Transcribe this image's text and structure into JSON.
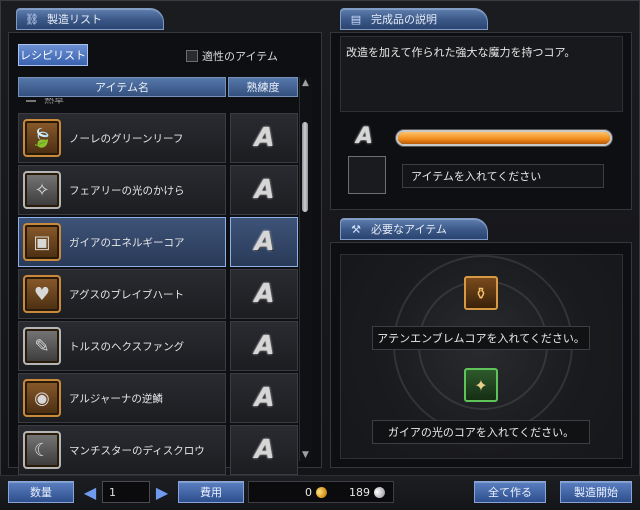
{
  "left_panel": {
    "title": "製造リスト",
    "recipe_list_button": "レシピリスト",
    "suitable_items_label": "適性のアイテム",
    "columns": {
      "item_name": "アイテム名",
      "proficiency": "熟練度"
    },
    "category": "熟草",
    "items": [
      {
        "name": "ノーレのグリーンリーフ",
        "grade": "A",
        "icon": "leaf-icon"
      },
      {
        "name": "フェアリーの光のかけら",
        "grade": "A",
        "icon": "crystal-icon"
      },
      {
        "name": "ガイアのエネルギーコア",
        "grade": "A",
        "icon": "core-icon",
        "selected": true
      },
      {
        "name": "アグスのブレイブハート",
        "grade": "A",
        "icon": "heart-icon"
      },
      {
        "name": "トルスのヘクスファング",
        "grade": "A",
        "icon": "fang-icon"
      },
      {
        "name": "アルジャーナの逆鱗",
        "grade": "A",
        "icon": "scale-icon"
      },
      {
        "name": "マンチスターのディスクロウ",
        "grade": "A",
        "icon": "claw-icon"
      }
    ]
  },
  "right_panel": {
    "desc_title": "完成品の説明",
    "description": "改造を加えて作られた強大な魔力を持つコア。",
    "grade": "A",
    "progress": 1.0,
    "item_slot_text": "アイテムを入れてください",
    "required_title": "必要なアイテム",
    "required": [
      {
        "label": "アテンエンブレムコアを入れてください。",
        "icon": "emblem-core-icon"
      },
      {
        "label": "ガイアの光のコアを入れてください。",
        "icon": "light-core-icon"
      }
    ]
  },
  "bottom_bar": {
    "quantity_label": "数量",
    "quantity_value": "1",
    "cost_label": "費用",
    "gold": "0",
    "silver": "189",
    "make_all": "全て作る",
    "start": "製造開始"
  },
  "colors": {
    "accent_blue": "#3a5786",
    "selected_row": "#3d5378",
    "progress_orange": "#f08a1a",
    "icon_frame_orange": "#c88a3a",
    "icon_frame_green": "#5ec45a"
  }
}
